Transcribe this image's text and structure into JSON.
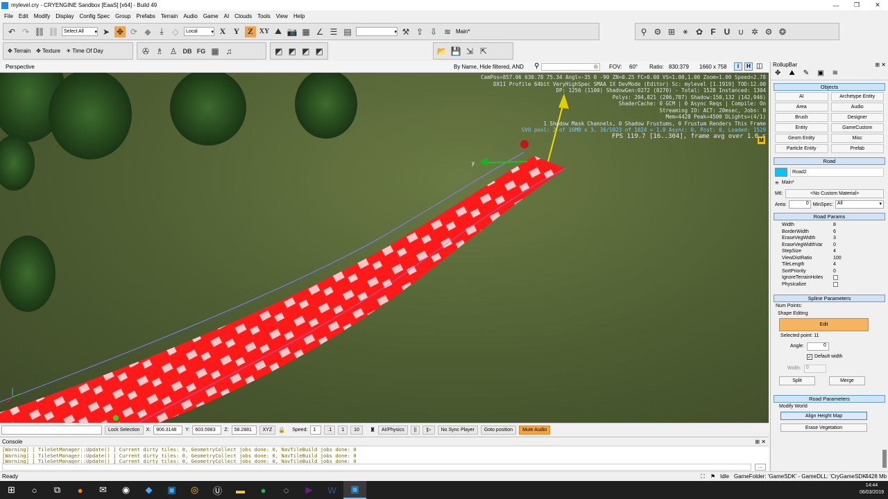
{
  "window": {
    "title": "mylevel.cry - CRYENGINE Sandbox [EaaS] [x64] - Build 49"
  },
  "menu": [
    "File",
    "Edit",
    "Modify",
    "Display",
    "Config Spec",
    "Group",
    "Prefabs",
    "Terrain",
    "Audio",
    "Game",
    "AI",
    "Clouds",
    "Tools",
    "View",
    "Help"
  ],
  "toolbar": {
    "select_filter": "Select All",
    "coord_system": "Local",
    "axis_x": "X",
    "axis_y": "Y",
    "axis_z": "Z",
    "axis_xy": "XY",
    "layer_name": "Main*",
    "terrain_label": "Terrain",
    "texture_label": "Texture",
    "time_of_day_label": "Time Of Day",
    "db_label": "DB",
    "fg_label": "FG"
  },
  "viewport": {
    "name": "Perspective",
    "filter_text": "By Name, Hide filtered, AND",
    "fov_label": "FOV:",
    "fov_value": "60°",
    "ratio_label": "Ratio:",
    "ratio_value": "830:379",
    "resolution": "1660 x 758",
    "btn_i": "i",
    "btn_h": "H",
    "hud_lines": [
      "CamPos=857.06 630.78 75.34 Angl=-35  0 -90 ZN=0.25 FC=0.00 VS=1.00,1.00 Zoom=1.00 Speed=2.78",
      "DX11 Profile 64bit VeryHighSpec SMAA 1X DevMode (Editor) Sc: mylevel [1.1919] TOD:12.00",
      "DP: 1256 (1100) ShadowGen:0272 (0270) - Total: 1528 Instanced: 1304",
      "Polys: 204,821 (206,787) Shadow:150,132 (142,946)",
      "ShaderCache: 0 GCM | 0 Async Reqs | Compile: On",
      "Streaming IO: ACT:  20msec, Jobs: 0",
      "Mem=4428 Peak=4500 DLights=(4/1)",
      "1 Shadow Mask Channels,   0 Shadow Frustums,   0 Frustum Renders This Frame"
    ],
    "svo_line": "SVO pool:  2 of 16MB x 3,  36/1023 of 1024 = 1.0 Async: 0, Post: 0, Loaded: 1529",
    "fps_line": "FPS 119.7 [16..304], frame avg over 1.0 s",
    "m_badge": "M",
    "gizmo_y_label": "y"
  },
  "viewport_bottom": {
    "lock_selection": "Lock Selection",
    "x_label": "X:",
    "x_value": "906.3148",
    "y_label": "Y:",
    "y_value": "603.5983",
    "z_label": "Z:",
    "z_value": "58.2881",
    "xyz": "XYZ",
    "speed_label": "Speed:",
    "speed_value": "1",
    "speed_01": ".1",
    "speed_1": "1",
    "speed_10": "10",
    "ai_physics": "AI/Physics",
    "no_sync_player": "No Sync Player",
    "goto_position": "Goto position",
    "mute_audio": "Mute Audio"
  },
  "console": {
    "title": "Console",
    "lines": [
      "[Warning] [ TileSetManager::Update() ] Current dirty tiles: 0, GeometryCollect jobs done: 0, NavTileBuild jobs done: 0",
      "[Warning] [ TileSetManager::Update() ] Current dirty tiles: 0, GeometryCollect jobs done: 0, NavTileBuild jobs done: 0",
      "[Warning] [ TileSetManager::Update() ] Current dirty tiles: 0, GeometryCollect jobs done: 0, NavTileBuild jobs done: 0"
    ],
    "more": "..."
  },
  "status": {
    "left": "Ready",
    "idle": "Idle",
    "game_folder": "GameFolder: 'GameSDK' - GameDLL: 'CryGameSDK'",
    "memory": "4428 Mb"
  },
  "rollup": {
    "title": "RollupBar",
    "objects_header": "Objects",
    "objects": [
      "AI",
      "Archetype Entity",
      "Area",
      "Audio",
      "Brush",
      "Designer",
      "Entity",
      "GameCustom",
      "Geom Entity",
      "Misc",
      "Particle Entity",
      "Prefab"
    ],
    "road_header": "Road",
    "road_name": "Road2",
    "road_layer": "Main*",
    "mtl_label": "Mtl:",
    "mtl_value": "<No Custom Material>",
    "area_label": "Area:",
    "area_value": "0",
    "minspec_label": "MinSpec:",
    "minspec_value": "All",
    "road_params_header": "Road Params",
    "params": [
      {
        "name": "Width",
        "value": "8"
      },
      {
        "name": "BorderWidth",
        "value": "6"
      },
      {
        "name": "EraseVegWidth",
        "value": "3"
      },
      {
        "name": "EraseVegWidthVar",
        "value": "0"
      },
      {
        "name": "StepSize",
        "value": "4"
      },
      {
        "name": "ViewDistRatio",
        "value": "100"
      },
      {
        "name": "TileLength",
        "value": "4"
      },
      {
        "name": "SortPriority",
        "value": "0"
      },
      {
        "name": "IgnoreTerrainHoles",
        "value": ""
      },
      {
        "name": "Physicalize",
        "value": ""
      }
    ],
    "spline_header": "Spline Parameters",
    "num_points": "Num Points:",
    "shape_editing": "Shape Editing",
    "edit_btn": "Edit",
    "selected_point": "Selected point: 11",
    "angle_label": "Angle:",
    "angle_value": "0",
    "default_width": "Default width",
    "width_label": "Width:",
    "width_value": "0",
    "split_btn": "Split",
    "merge_btn": "Merge",
    "road_parameters_header": "Road Parameters",
    "modify_world": "Modify World",
    "align_height_map": "Align Height Map",
    "erase_vegetation": "Erase Vegetation"
  },
  "taskbar": {
    "time": "14:44",
    "date": "06/03/2019"
  },
  "colors": {
    "road": "#ff1a1a",
    "accent_orange": "#f0a34b",
    "road_swatch": "#00c8ff"
  }
}
